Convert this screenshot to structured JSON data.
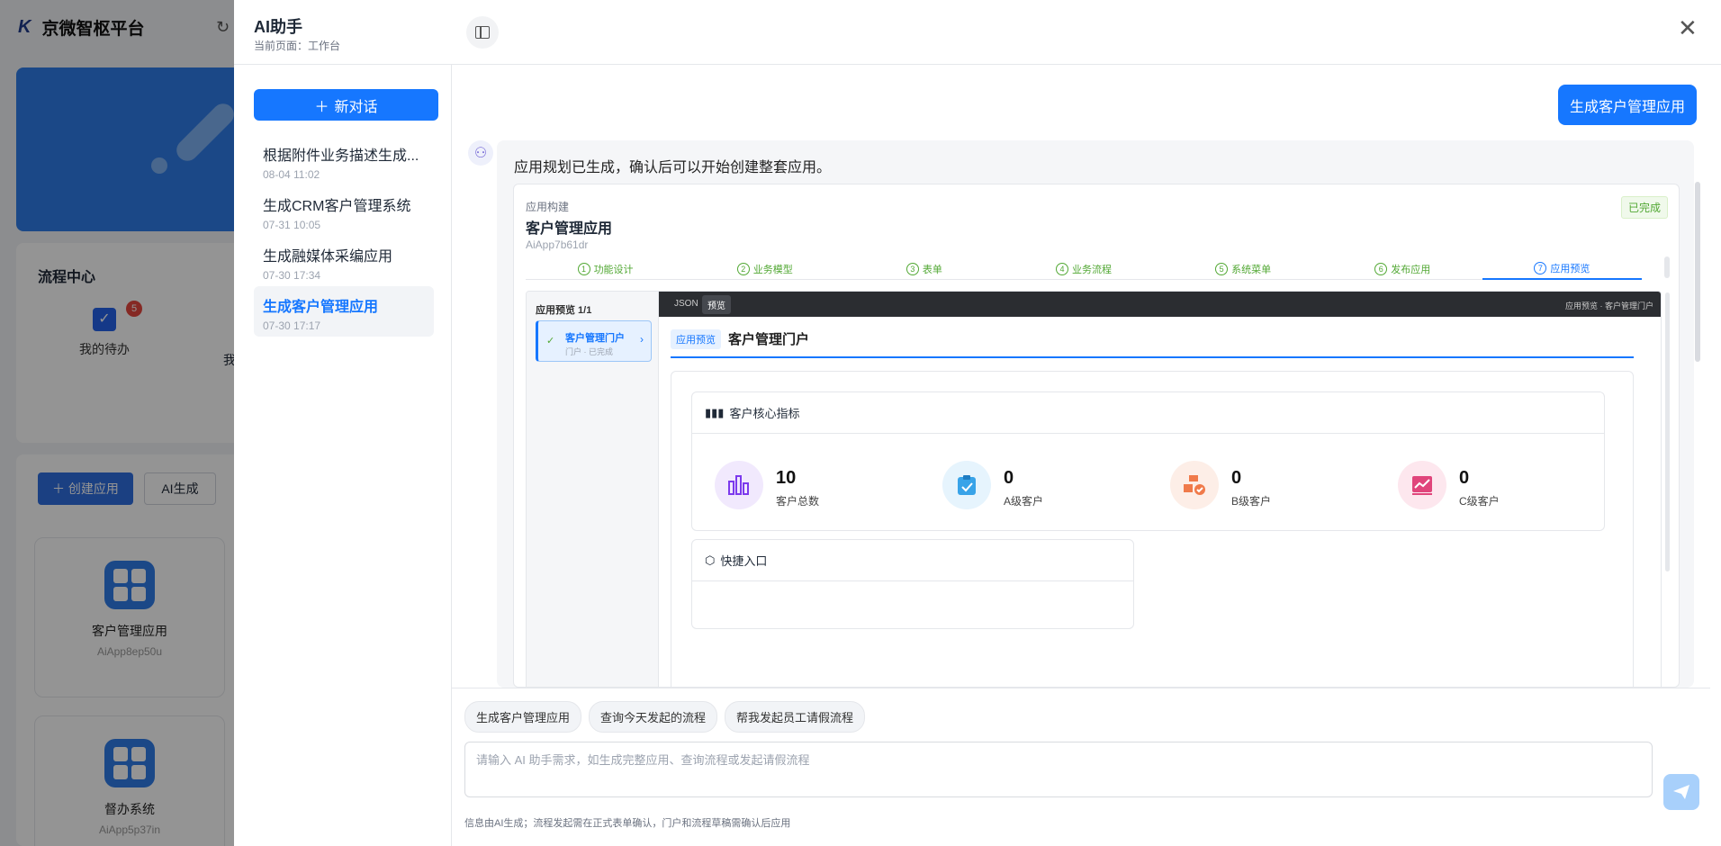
{
  "background": {
    "logo": "K",
    "title": "京微智枢平台",
    "flow_center": {
      "title": "流程中心",
      "todo_label": "我的待办",
      "todo_badge": "5",
      "clipped_label": "我"
    },
    "apps": {
      "create_label": "创建应用",
      "ai_gen_label": "AI生成",
      "cards": [
        {
          "name": "客户管理应用",
          "code": "AiApp8ep50u"
        },
        {
          "name": "督办系统",
          "code": "AiApp5p37in"
        }
      ]
    }
  },
  "drawer": {
    "title": "AI助手",
    "subtitle": "当前页面：工作台",
    "new_chat_label": "新对话",
    "conversations": [
      {
        "title": "根据附件业务描述生成...",
        "date": "08-04 11:02",
        "active": false
      },
      {
        "title": "生成CRM客户管理系统",
        "date": "07-31 10:05",
        "active": false
      },
      {
        "title": "生成融媒体采编应用",
        "date": "07-30 17:34",
        "active": false
      },
      {
        "title": "生成客户管理应用",
        "date": "07-30 17:17",
        "active": true
      }
    ],
    "user_message": "生成客户管理应用",
    "bot_message": "应用规划已生成，确认后可以开始创建整套应用。",
    "build": {
      "label": "应用构建",
      "name": "客户管理应用",
      "code": "AiApp7b61dr",
      "status": "已完成",
      "steps": [
        {
          "n": "1",
          "label": "功能设计"
        },
        {
          "n": "2",
          "label": "业务模型"
        },
        {
          "n": "3",
          "label": "表单"
        },
        {
          "n": "4",
          "label": "业务流程"
        },
        {
          "n": "5",
          "label": "系统菜单"
        },
        {
          "n": "6",
          "label": "发布应用"
        },
        {
          "n": "7",
          "label": "应用预览"
        }
      ],
      "preview": {
        "list_title": "应用预览 1/1",
        "item_title": "客户管理门户",
        "item_sub": "门户 · 已完成",
        "tab_json": "JSON",
        "tab_preview": "预览",
        "breadcrumb": "应用预览 · 客户管理门户",
        "page_tag": "应用预览",
        "page_title": "客户管理门户",
        "metrics_title": "客户核心指标",
        "metrics": [
          {
            "value": "10",
            "label": "客户总数",
            "color": "#7c3aed",
            "bg": "#f1e9fd"
          },
          {
            "value": "0",
            "label": "A级客户",
            "color": "#38a3e8",
            "bg": "#e6f4fd"
          },
          {
            "value": "0",
            "label": "B级客户",
            "color": "#f07a4a",
            "bg": "#fdeee7"
          },
          {
            "value": "0",
            "label": "C级客户",
            "color": "#e0457b",
            "bg": "#fde7ee"
          }
        ],
        "quick_title": "快捷入口"
      }
    },
    "suggestions": [
      "生成客户管理应用",
      "查询今天发起的流程",
      "帮我发起员工请假流程"
    ],
    "input_placeholder": "请输入 AI 助手需求，如生成完整应用、查询流程或发起请假流程",
    "footer_note": "信息由AI生成；流程发起需在正式表单确认，门户和流程草稿需确认后应用"
  }
}
